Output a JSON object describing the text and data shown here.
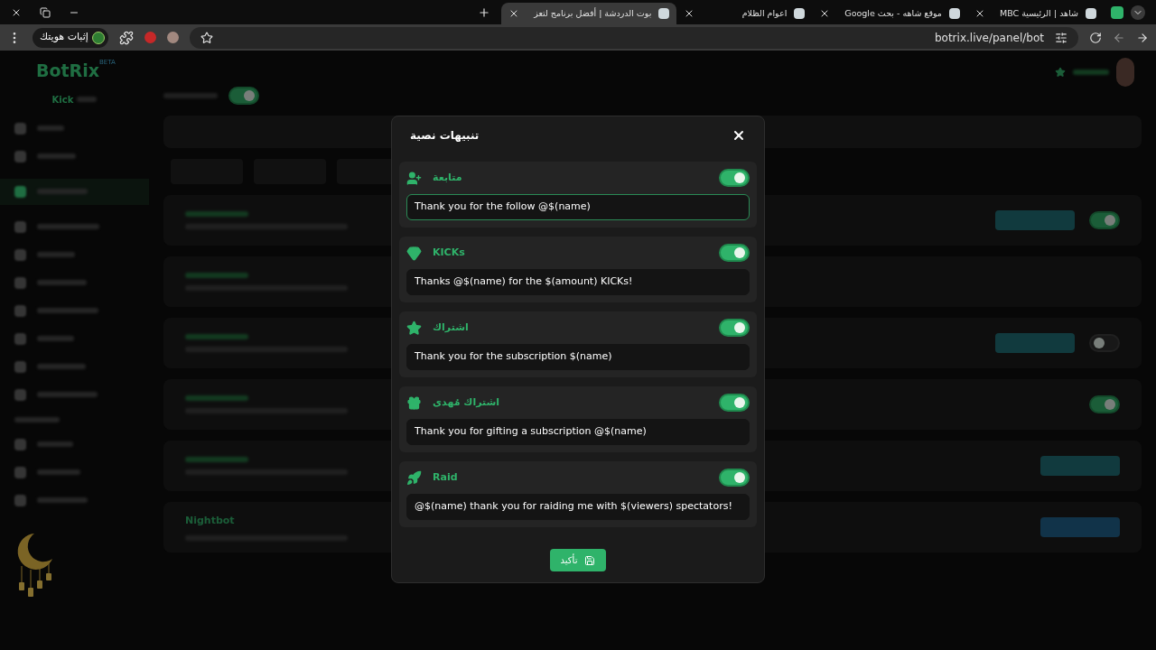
{
  "browser": {
    "tabs": [
      {
        "title": "شاهد | الرئيسية MBC",
        "selected": false
      },
      {
        "title": "موقع شاهه - بحث Google",
        "selected": false
      },
      {
        "title": "اعوام الظلام",
        "selected": false
      },
      {
        "title": "بوت الدردشة | أفضل برنامج لتعز",
        "selected": true
      }
    ],
    "url": "botrix.live/panel/bot",
    "profile_button": "إثبات هويتك"
  },
  "background": {
    "logo": "BotRix",
    "logo_badge": "BETA",
    "platform": "Kick",
    "page_toggle_on": true,
    "nightbot": "Nightbot",
    "row_toggles": [
      true,
      false,
      true
    ]
  },
  "modal": {
    "title": "تنبيهات نصية",
    "alerts": [
      {
        "label": "متابعة",
        "message": "Thank you for the follow @$(name)",
        "on": true,
        "focused": true
      },
      {
        "label": "KICKs",
        "message": "Thanks @$(name) for the $(amount) KICKs!",
        "on": true,
        "focused": false
      },
      {
        "label": "اشتراك",
        "message": "Thank you for the subscription $(name)",
        "on": true,
        "focused": false
      },
      {
        "label": "اشتراك مُهدى",
        "message": "Thank you for gifting a subscription @$(name)",
        "on": true,
        "focused": false
      },
      {
        "label": "Raid",
        "message": "@$(name) thank you for raiding me with $(viewers) spectators!",
        "on": true,
        "focused": false
      }
    ],
    "confirm": "تأكيد"
  }
}
